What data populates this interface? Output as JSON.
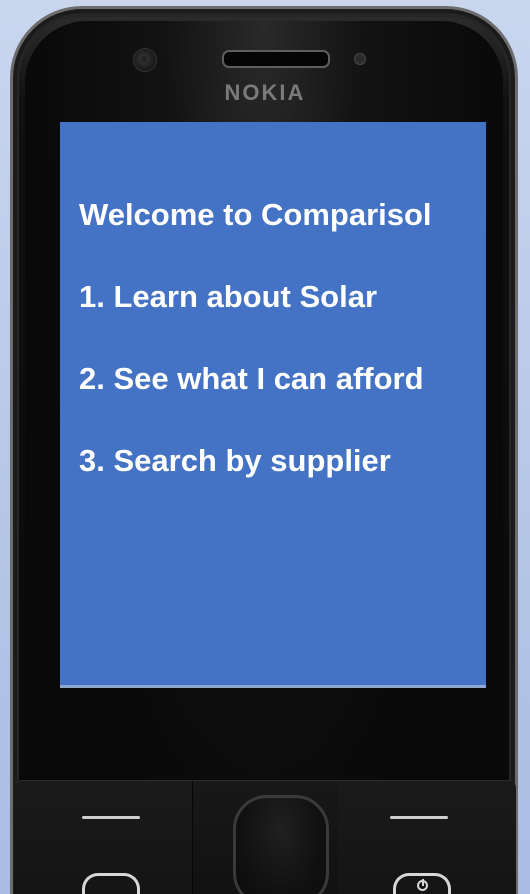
{
  "device": {
    "brand": "NOKIA"
  },
  "screen": {
    "background_color": "#4472c4",
    "text_color": "#ffffff",
    "welcome": "Welcome to Comparisol",
    "menu": [
      {
        "label": "1. Learn about Solar"
      },
      {
        "label": "2. See what I can afford"
      },
      {
        "label": "3. Search by supplier"
      }
    ]
  },
  "keys": {
    "left_soft_key_icon": "dash-icon",
    "right_soft_key_icon": "dash-icon",
    "nav_key_icon": "navigation-pad",
    "call_key_icon": "call-icon",
    "end_key_icon": "power-icon"
  }
}
